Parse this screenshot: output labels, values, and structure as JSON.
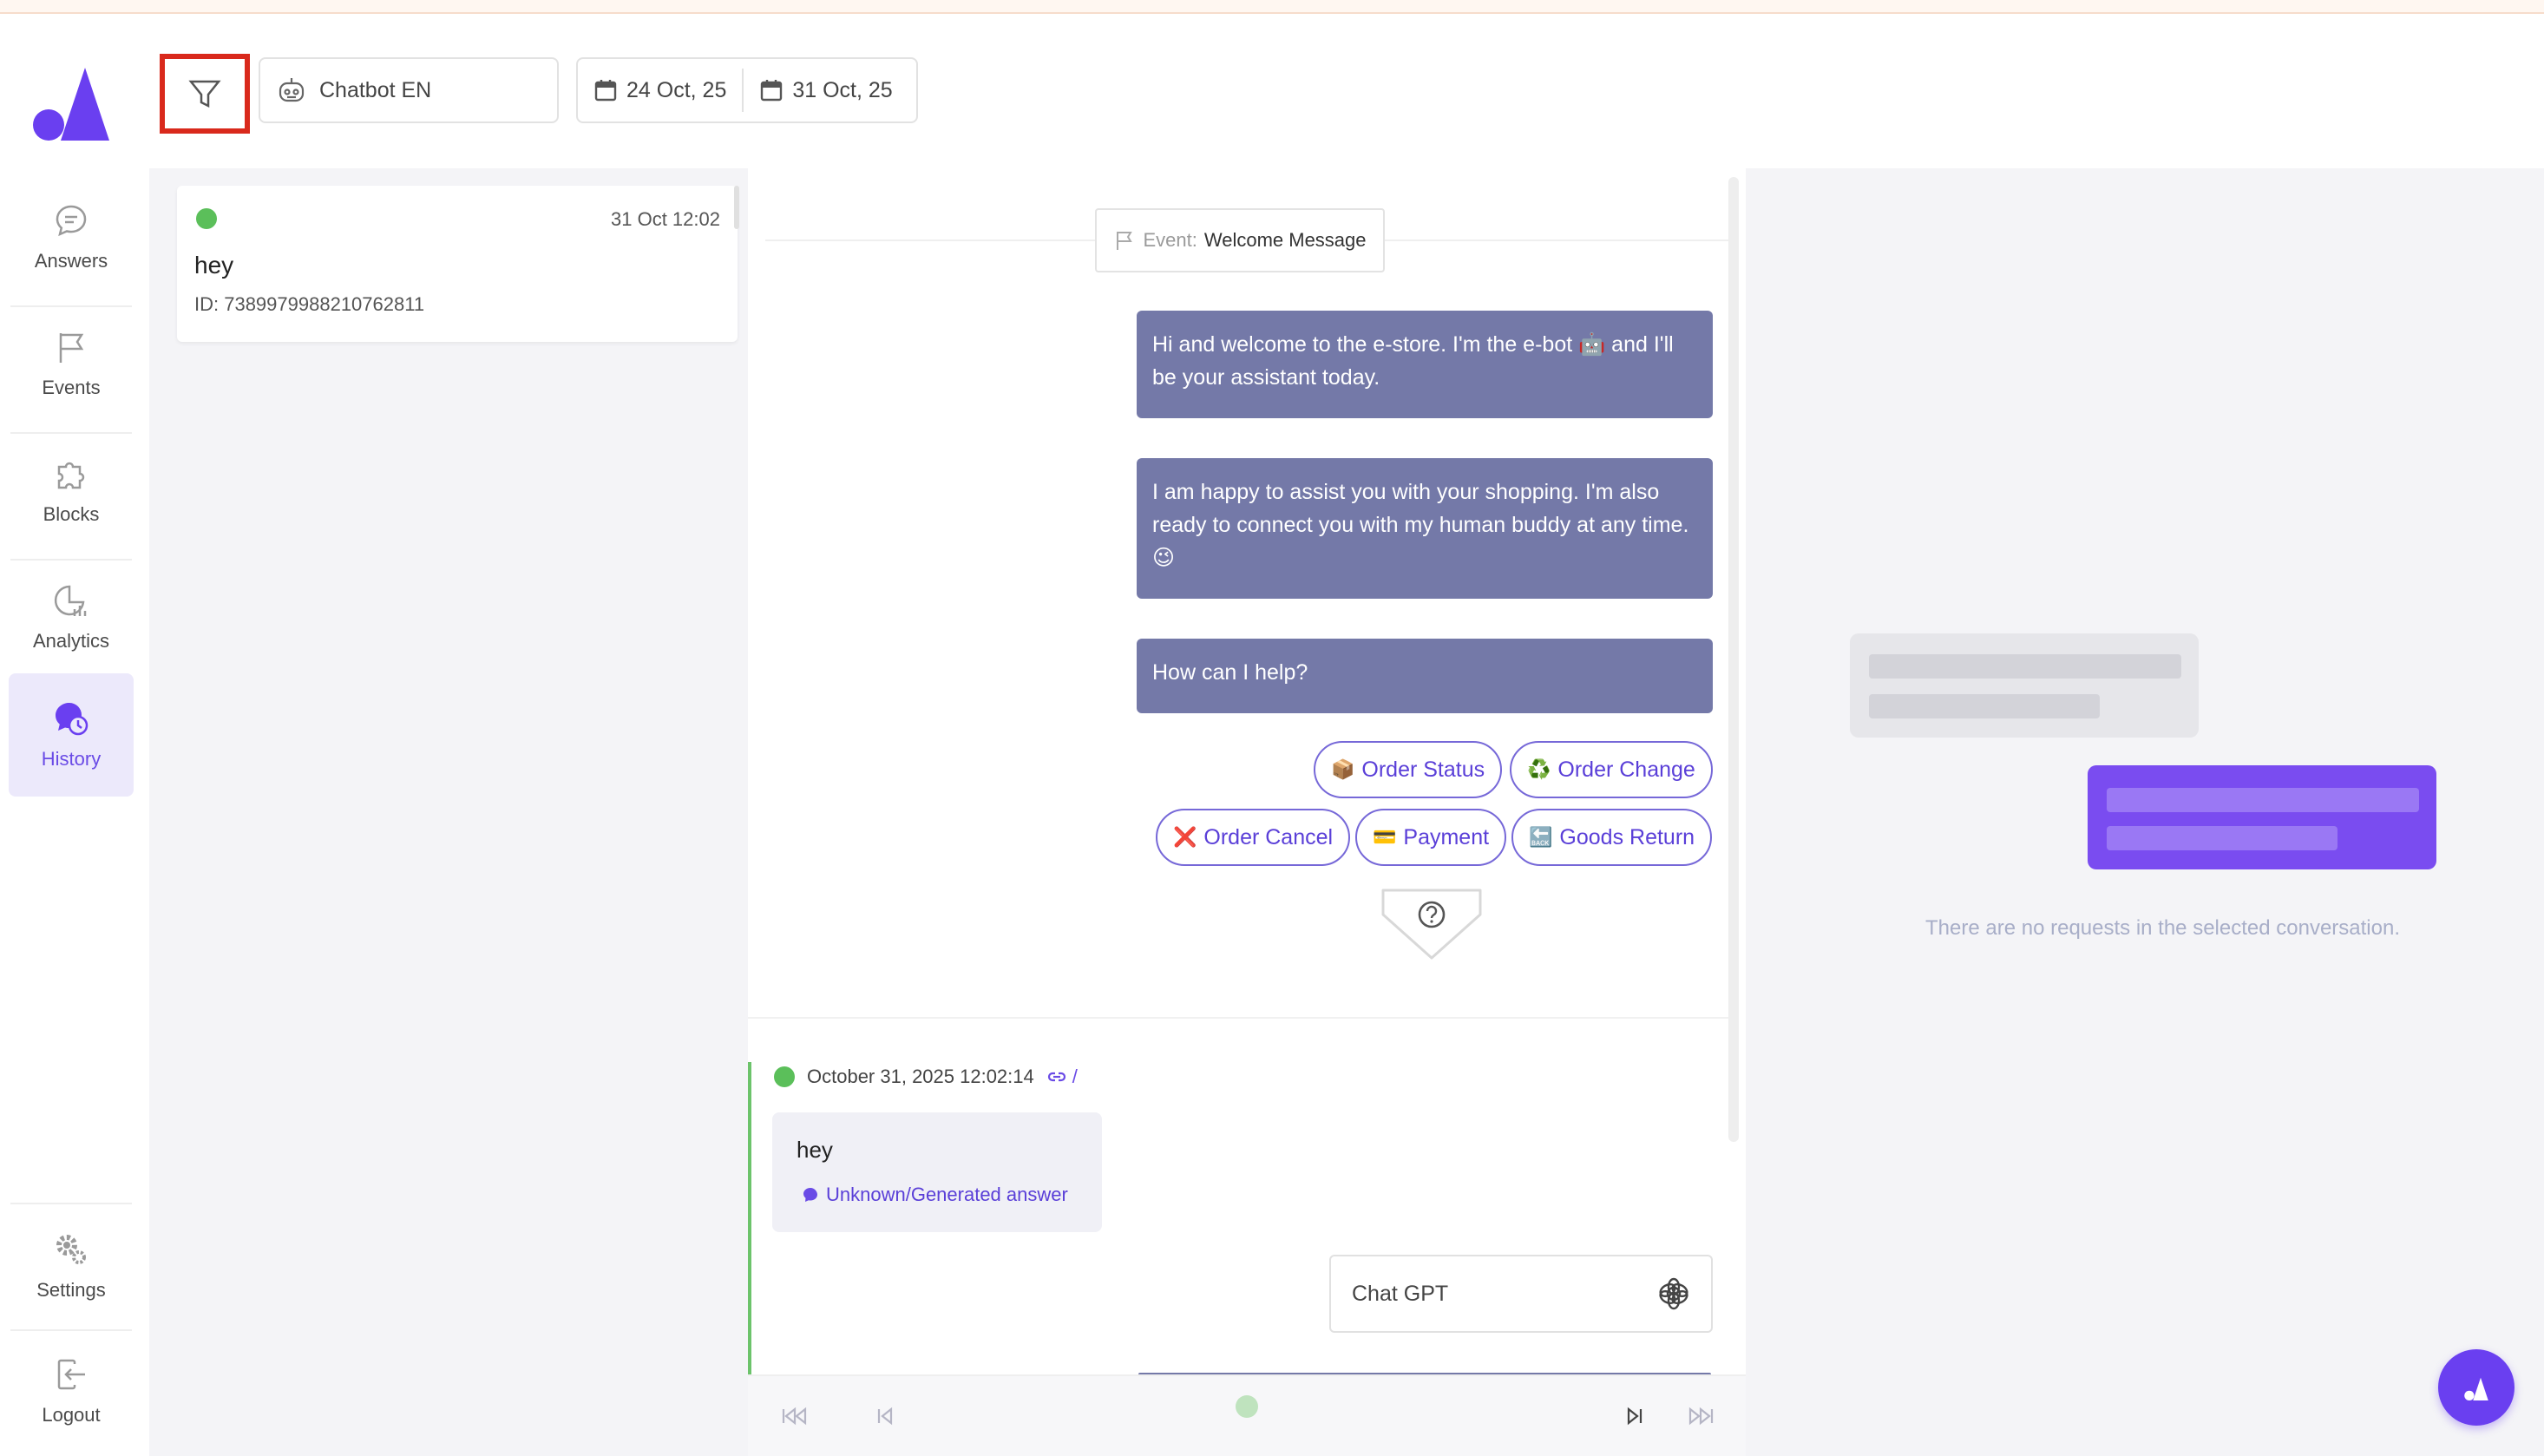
{
  "sidebar": {
    "items": [
      {
        "label": "Answers",
        "icon": "chat-bubble-icon"
      },
      {
        "label": "Events",
        "icon": "flag-icon"
      },
      {
        "label": "Blocks",
        "icon": "puzzle-icon"
      },
      {
        "label": "Analytics",
        "icon": "pie-chart-icon"
      },
      {
        "label": "History",
        "icon": "history-icon",
        "active": true
      },
      {
        "label": "Settings",
        "icon": "gear-icon"
      },
      {
        "label": "Logout",
        "icon": "logout-icon"
      }
    ]
  },
  "toolbar": {
    "bot_name": "Chatbot EN",
    "date_from": "24 Oct, 25",
    "date_to": "31 Oct, 25"
  },
  "conversations": [
    {
      "time": "31 Oct 12:02",
      "title": "hey",
      "id": "ID: 7389979988210762811",
      "status_color": "#5bbf5a"
    }
  ],
  "chat": {
    "event_prefix": "Event:",
    "event_name": "Welcome Message",
    "bot_messages": [
      "Hi and welcome to the e-store. I'm the e-bot 🤖 and I'll be your assistant today.",
      "I am happy to assist you with your shopping. I'm also ready to connect you with my human buddy at any time. 😉",
      "How can I help?"
    ],
    "quick_replies": [
      {
        "emoji": "📦",
        "label": "Order Status"
      },
      {
        "emoji": "♻️",
        "label": "Order Change"
      },
      {
        "emoji": "❌",
        "label": "Order Cancel"
      },
      {
        "emoji": "💳",
        "label": "Payment"
      },
      {
        "emoji": "🔙",
        "label": "Goods Return"
      }
    ],
    "message": {
      "timestamp": "October 31, 2025 12:02:14",
      "link_text": "/",
      "text": "hey",
      "answer_type": "Unknown/Generated answer",
      "engine": "Chat GPT"
    }
  },
  "right_panel": {
    "empty_text": "There are no requests in the selected conversation."
  },
  "colors": {
    "accent": "#6a4be6",
    "bot_bubble": "#7479a8",
    "status_green": "#5bbf5a",
    "highlight_red": "#d9291c"
  }
}
